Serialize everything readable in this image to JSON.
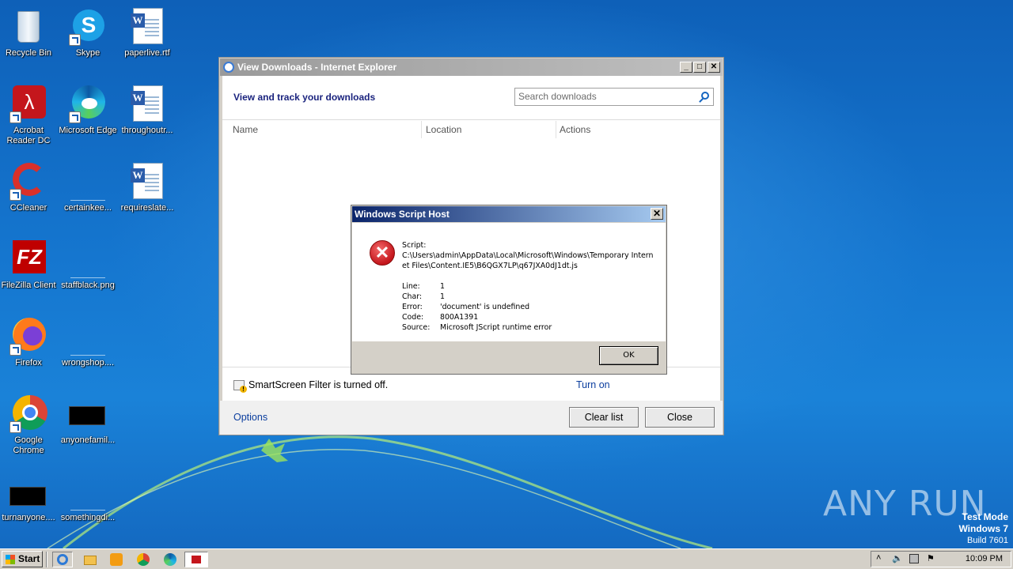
{
  "desktop": {
    "icons": [
      {
        "label": "Recycle Bin"
      },
      {
        "label": "Skype"
      },
      {
        "label": "paperlive.rtf"
      },
      {
        "label": "Acrobat Reader DC"
      },
      {
        "label": "Microsoft Edge"
      },
      {
        "label": "throughoutr..."
      },
      {
        "label": "CCleaner"
      },
      {
        "label": "certainkee..."
      },
      {
        "label": "requireslate..."
      },
      {
        "label": "FileZilla Client"
      },
      {
        "label": "staffblack.png"
      },
      {
        "label": "Firefox"
      },
      {
        "label": "wrongshop...."
      },
      {
        "label": "Google Chrome"
      },
      {
        "label": "anyonefamil..."
      },
      {
        "label": "turnanyone...."
      },
      {
        "label": "somethingdi..."
      }
    ]
  },
  "ie_window": {
    "title": "View Downloads - Internet Explorer",
    "header": "View and track your downloads",
    "search_placeholder": "Search downloads",
    "columns": [
      "Name",
      "Location",
      "Actions"
    ],
    "smartscreen_text": "SmartScreen Filter is turned off.",
    "turn_on_label": "Turn on",
    "options_label": "Options",
    "clear_list_label": "Clear list",
    "close_label": "Close"
  },
  "dialog": {
    "title": "Windows Script Host",
    "script_label": "Script:",
    "script_path": "C:\\Users\\admin\\AppData\\Local\\Microsoft\\Windows\\Temporary Internet Files\\Content.IE5\\B6QGX7LP\\q67JXA0dJ1dt.js",
    "fields": [
      {
        "key": "Line:",
        "value": "1"
      },
      {
        "key": "Char:",
        "value": "1"
      },
      {
        "key": "Error:",
        "value": "'document' is undefined"
      },
      {
        "key": "Code:",
        "value": "800A1391"
      },
      {
        "key": "Source:",
        "value": "Microsoft JScript runtime error"
      }
    ],
    "ok_label": "OK"
  },
  "taskbar": {
    "start_label": "Start",
    "clock": "10:09 PM"
  },
  "watermark": "ANY RUN",
  "test_mode": {
    "line1": "Test Mode",
    "line2": "Windows 7",
    "line3": "Build 7601"
  }
}
